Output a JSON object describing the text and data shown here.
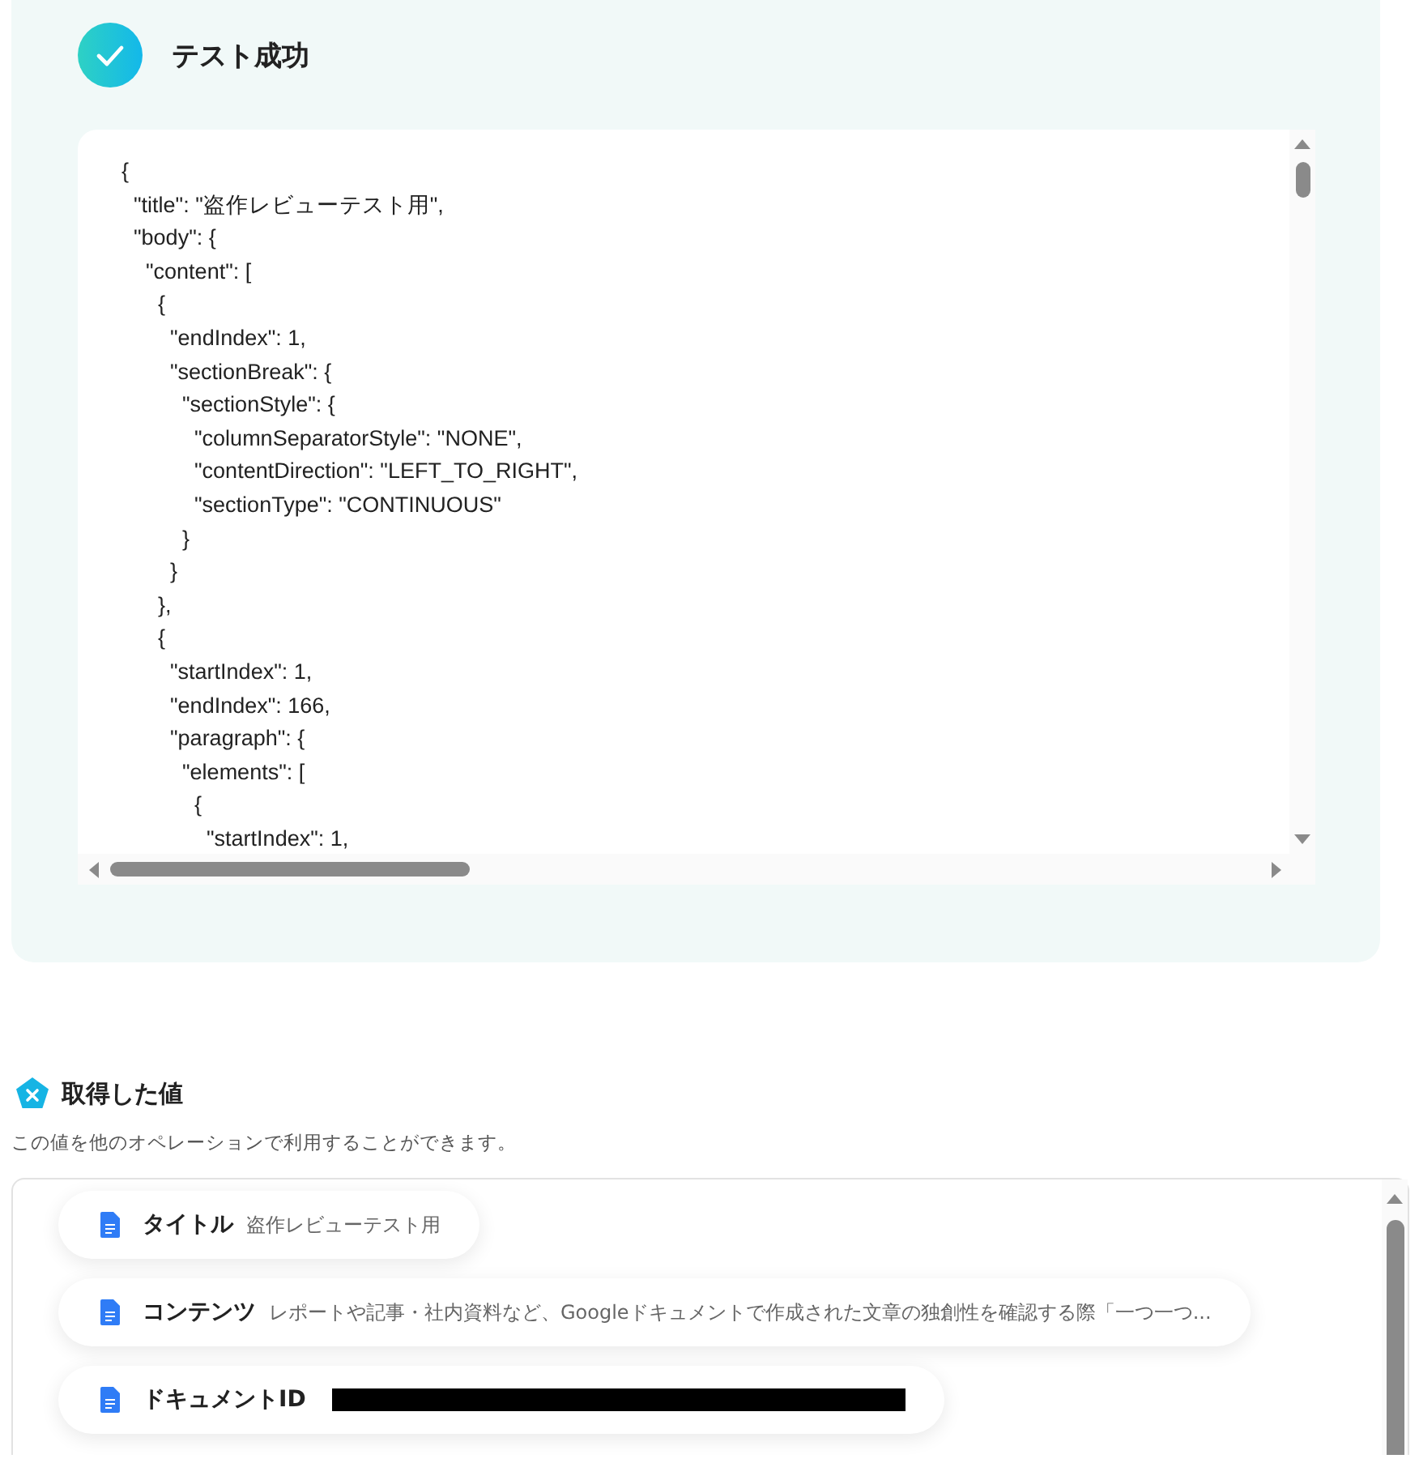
{
  "test_result": {
    "title": "テスト成功",
    "code_lines": [
      "{",
      "  \"title\": \"盗作レビューテスト用\",",
      "  \"body\": {",
      "    \"content\": [",
      "      {",
      "        \"endIndex\": 1,",
      "        \"sectionBreak\": {",
      "          \"sectionStyle\": {",
      "            \"columnSeparatorStyle\": \"NONE\",",
      "            \"contentDirection\": \"LEFT_TO_RIGHT\",",
      "            \"sectionType\": \"CONTINUOUS\"",
      "          }",
      "        }",
      "      },",
      "      {",
      "        \"startIndex\": 1,",
      "        \"endIndex\": 166,",
      "        \"paragraph\": {",
      "          \"elements\": [",
      "            {",
      "              \"startIndex\": 1,"
    ]
  },
  "values_section": {
    "title": "取得した値",
    "description": "この値を他のオペレーションで利用することができます。",
    "items": [
      {
        "kind": "text",
        "label": "タイトル",
        "value": "盗作レビューテスト用"
      },
      {
        "kind": "text",
        "label": "コンテンツ",
        "value": "レポートや記事・社内資料など、Googleドキュメントで作成された文章の独創性を確認する際「一つ一つ..."
      },
      {
        "kind": "redacted",
        "label": "ドキュメントID"
      }
    ]
  }
}
